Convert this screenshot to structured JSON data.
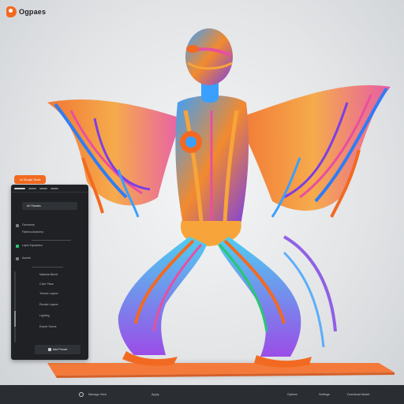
{
  "app": {
    "logo_text": "Ogpaes",
    "brand_color": "#f26a21"
  },
  "panel": {
    "tag_label": "AI Sculpt Tools",
    "rows": [
      "Art Tweaks",
      "Geometry",
      "Fabrica Anatomy",
      "Layer Dynamics",
      "Assets",
      "Material Blend",
      "Color Pass",
      "Texture Layers",
      "Render Layers",
      "Lighting",
      "Export Scene"
    ],
    "button_label": "Add Preset"
  },
  "bottombar": {
    "left_label": "Manage View",
    "center_label": "Apply",
    "right_items": [
      "Options",
      "Settings",
      "Download Model"
    ]
  }
}
